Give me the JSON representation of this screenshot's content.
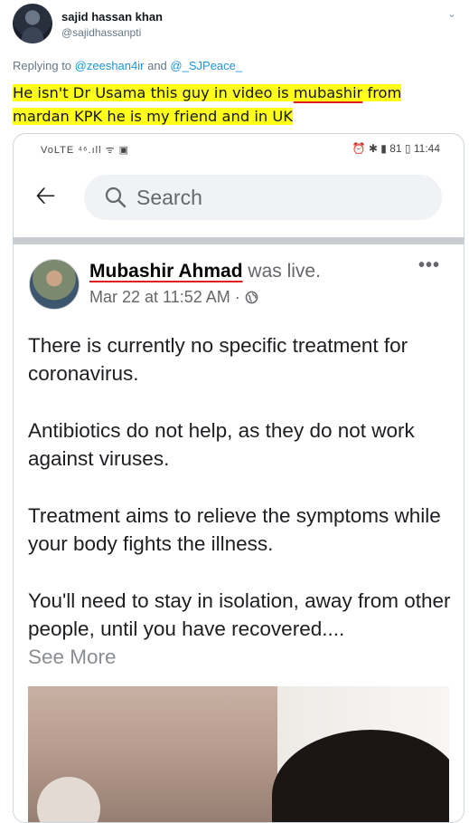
{
  "tweet": {
    "display_name": "sajid hassan khan",
    "handle": "@sajidhassanpti",
    "reply_prefix": "Replying to",
    "reply_mention_1": "@zeeshan4ir",
    "reply_and": "and",
    "reply_mention_2": "@_SJPeace_",
    "text_1": "He isn't Dr Usama this guy in video is ",
    "text_underlined": "mubashir",
    "text_2": " from",
    "text_3": "mardan KPK he is my friend and in UK"
  },
  "screenshot": {
    "status": {
      "left": "VoLTE ⁴⁶.ıll ᯤ ▣",
      "right": "⏰ ✱ ▮ 81 ▯ 11:44"
    },
    "search_placeholder": "Search",
    "post": {
      "author": "Mubashir Ahmad",
      "action": "was live.",
      "timestamp": "Mar 22 at 11:52 AM",
      "meta_sep": "·",
      "more": "•••",
      "paragraphs": [
        "There is currently no specific treatment for coronavirus.",
        "Antibiotics do not help, as they do not work against viruses.",
        "Treatment aims to relieve the symptoms while your body fights the illness.",
        "You'll need to stay in isolation, away from other people, until you have recovered...."
      ],
      "see_more": "See More"
    }
  },
  "colors": {
    "highlight": "#ffff1a",
    "mention": "#1b95e0",
    "underline_red": "#e02020"
  },
  "icons": [
    "avatar",
    "chevron-down-icon",
    "back-arrow-icon",
    "search-icon",
    "globe-icon",
    "more-options-icon"
  ]
}
